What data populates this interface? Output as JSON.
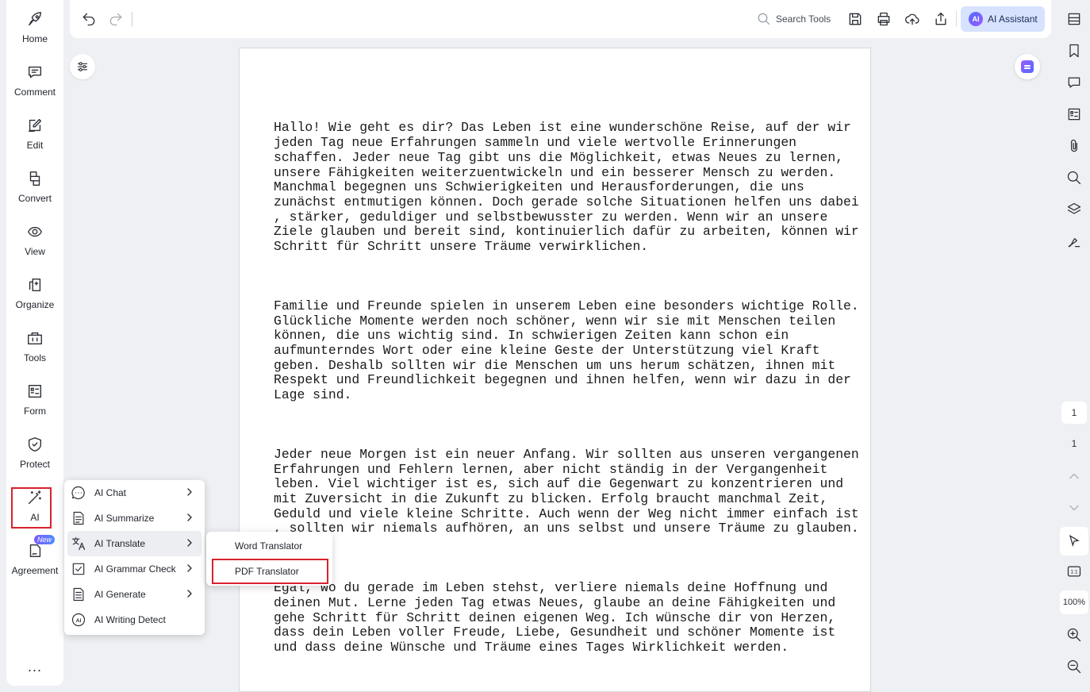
{
  "left_nav": {
    "items": [
      {
        "label": "Home",
        "icon": "rocket-icon"
      },
      {
        "label": "Comment",
        "icon": "comment-icon"
      },
      {
        "label": "Edit",
        "icon": "edit-icon"
      },
      {
        "label": "Convert",
        "icon": "convert-icon"
      },
      {
        "label": "View",
        "icon": "eye-icon"
      },
      {
        "label": "Organize",
        "icon": "organize-icon"
      },
      {
        "label": "Tools",
        "icon": "toolbox-icon"
      },
      {
        "label": "Form",
        "icon": "form-icon"
      },
      {
        "label": "Protect",
        "icon": "shield-icon"
      },
      {
        "label": "AI",
        "icon": "magic-wand-icon"
      },
      {
        "label": "Agreement",
        "icon": "agreement-icon",
        "badge": "New"
      }
    ],
    "more": "..."
  },
  "toolbar": {
    "search_label": "Search Tools",
    "ai_assistant_label": "AI Assistant",
    "ai_logo_text": "AI"
  },
  "document": {
    "paragraphs": [
      "Hallo! Wie geht es dir? Das Leben ist eine wunderschöne Reise, auf der wir\njeden Tag neue Erfahrungen sammeln und viele wertvolle Erinnerungen\nschaffen. Jeder neue Tag gibt uns die Möglichkeit, etwas Neues zu lernen,\nunsere Fähigkeiten weiterzuentwickeln und ein besserer Mensch zu werden.\nManchmal begegnen uns Schwierigkeiten und Herausforderungen, die uns\nzunächst entmutigen können. Doch gerade solche Situationen helfen uns dabei\n, stärker, geduldiger und selbstbewusster zu werden. Wenn wir an unsere\nZiele glauben und bereit sind, kontinuierlich dafür zu arbeiten, können wir\nSchritt für Schritt unsere Träume verwirklichen.",
      "Familie und Freunde spielen in unserem Leben eine besonders wichtige Rolle.\nGlückliche Momente werden noch schöner, wenn wir sie mit Menschen teilen\nkönnen, die uns wichtig sind. In schwierigen Zeiten kann schon ein\naufmunterndes Wort oder eine kleine Geste der Unterstützung viel Kraft\ngeben. Deshalb sollten wir die Menschen um uns herum schätzen, ihnen mit\nRespekt und Freundlichkeit begegnen und ihnen helfen, wenn wir dazu in der\nLage sind.",
      "Jeder neue Morgen ist ein neuer Anfang. Wir sollten aus unseren vergangenen\nErfahrungen und Fehlern lernen, aber nicht ständig in der Vergangenheit\nleben. Viel wichtiger ist es, sich auf die Gegenwart zu konzentrieren und\nmit Zuversicht in die Zukunft zu blicken. Erfolg braucht manchmal Zeit,\nGeduld und viele kleine Schritte. Auch wenn der Weg nicht immer einfach ist\n, sollten wir niemals aufhören, an uns selbst und unsere Träume zu glauben.",
      "Egal, wo du gerade im Leben stehst, verliere niemals deine Hoffnung und\ndeinen Mut. Lerne jeden Tag etwas Neues, glaube an deine Fähigkeiten und\ngehe Schritt für Schritt deinen eigenen Weg. Ich wünsche dir von Herzen,\ndass dein Leben voller Freude, Liebe, Gesundheit und schöner Momente ist\nund dass deine Wünsche und Träume eines Tages Wirklichkeit werden."
    ]
  },
  "ai_menu": {
    "items": [
      {
        "label": "AI Chat",
        "icon": "ai-chat-icon",
        "has_submenu": true
      },
      {
        "label": "AI Summarize",
        "icon": "summarize-icon",
        "has_submenu": true
      },
      {
        "label": "AI Translate",
        "icon": "translate-icon",
        "has_submenu": true,
        "active": true
      },
      {
        "label": "AI Grammar Check",
        "icon": "grammar-check-icon",
        "has_submenu": true
      },
      {
        "label": "AI Generate",
        "icon": "generate-icon",
        "has_submenu": true
      },
      {
        "label": "AI Writing Detect",
        "icon": "writing-detect-icon",
        "has_submenu": false
      }
    ]
  },
  "translate_submenu": {
    "items": [
      {
        "label": "Word Translator"
      },
      {
        "label": "PDF Translator",
        "highlighted": true
      }
    ]
  },
  "pager": {
    "current_page": "1",
    "total_pages": "1",
    "zoom": "100%",
    "fit_label": "1:1"
  },
  "colors": {
    "highlight_red": "#d9222d",
    "ai_button_bg": "#d7e2ff",
    "app_bg": "#eef0f3"
  }
}
